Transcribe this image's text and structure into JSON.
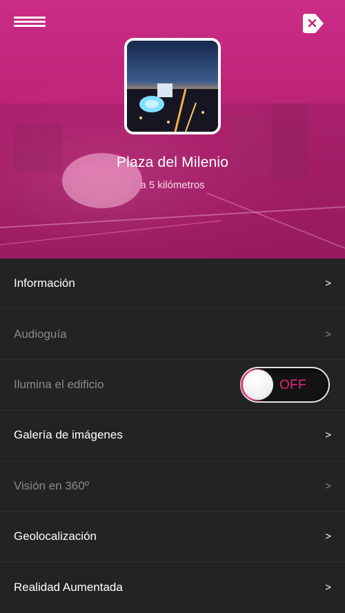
{
  "header": {
    "menu_icon": "hamburger-icon",
    "close_icon": "close-tag-icon",
    "accent_color": "#d62e8e",
    "place_name": "Plaza del Milenio",
    "distance": "a 5 kilómetros"
  },
  "menu": {
    "items": [
      {
        "label": "Información",
        "arrow": ">",
        "enabled": true
      },
      {
        "label": "Audioguía",
        "arrow": ">",
        "enabled": false
      },
      {
        "label": "Ilumina el edificio",
        "enabled": false
      },
      {
        "label": "Galería de imágenes",
        "arrow": ">",
        "enabled": true
      },
      {
        "label": "Visión en 360º",
        "arrow": ">",
        "enabled": false
      },
      {
        "label": "Geolocalización",
        "arrow": ">",
        "enabled": true
      },
      {
        "label": "Realidad Aumentada",
        "arrow": ">",
        "enabled": true
      }
    ],
    "toggle": {
      "state": "OFF",
      "on_color": "#e3267f"
    }
  }
}
